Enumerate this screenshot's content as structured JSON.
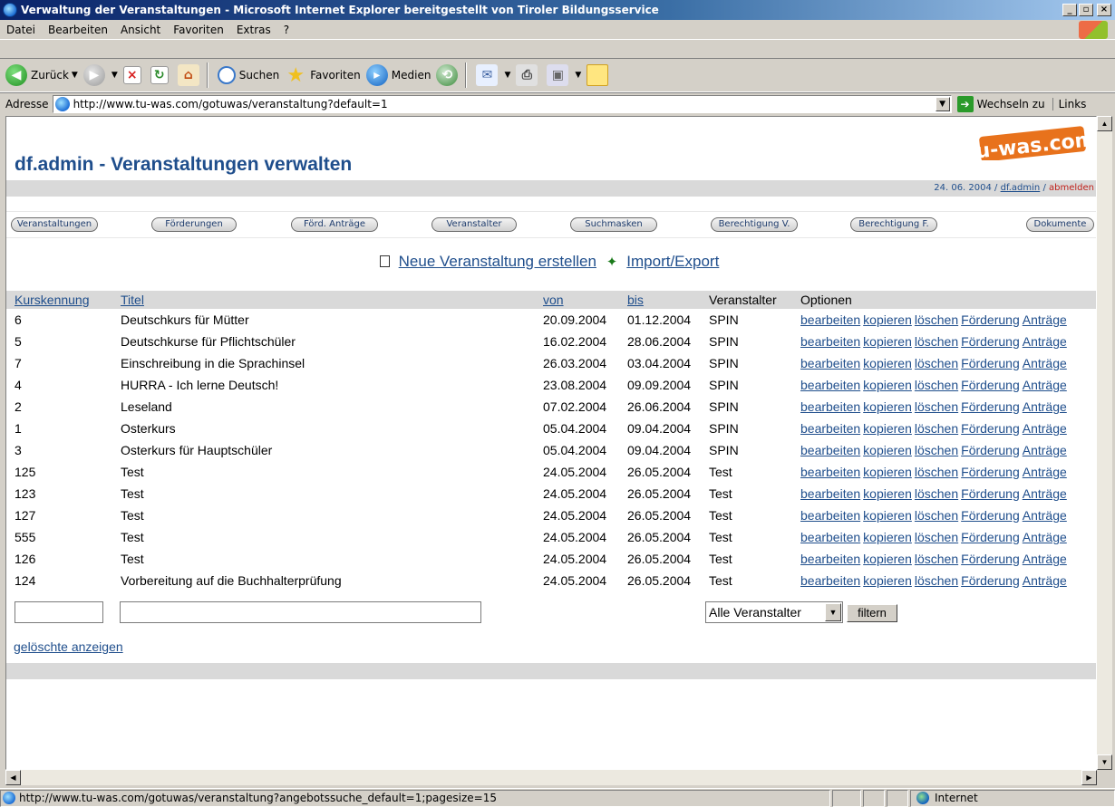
{
  "window": {
    "title": "Verwaltung der Veranstaltungen - Microsoft Internet Explorer bereitgestellt von Tiroler Bildungsservice",
    "min": "_",
    "max": "▫",
    "close": "×"
  },
  "menu": [
    "Datei",
    "Bearbeiten",
    "Ansicht",
    "Favoriten",
    "Extras",
    "?"
  ],
  "toolbar": {
    "back": "Zurück",
    "search": "Suchen",
    "favorites": "Favoriten",
    "media": "Medien"
  },
  "address": {
    "label": "Adresse",
    "url": "http://www.tu-was.com/gotuwas/veranstaltung?default=1",
    "go": "Wechseln zu",
    "links": "Links"
  },
  "page": {
    "title": "df.admin - Veranstaltungen verwalten",
    "logo": "tu-was.com",
    "date": "24. 06. 2004",
    "user": "df.admin",
    "logout": "abmelden",
    "nav": [
      "Veranstaltungen",
      "Förderungen",
      "Förd. Anträge",
      "Veranstalter",
      "Suchmasken",
      "Berechtigung V.",
      "Berechtigung F.",
      "Dokumente"
    ],
    "actions": {
      "new": "Neue Veranstaltung erstellen",
      "import": "Import/Export"
    },
    "headers": {
      "id": "Kurskennung",
      "title": "Titel",
      "from": "von",
      "to": "bis",
      "organizer": "Veranstalter",
      "options": "Optionen"
    },
    "option_labels": [
      "bearbeiten",
      "kopieren",
      "löschen",
      "Förderung",
      "Anträge"
    ],
    "rows": [
      [
        "6",
        "Deutschkurs für Mütter",
        "20.09.2004",
        "01.12.2004",
        "SPIN"
      ],
      [
        "5",
        "Deutschkurse für Pflichtschüler",
        "16.02.2004",
        "28.06.2004",
        "SPIN"
      ],
      [
        "7",
        "Einschreibung in die Sprachinsel",
        "26.03.2004",
        "03.04.2004",
        "SPIN"
      ],
      [
        "4",
        "HURRA - Ich lerne Deutsch!",
        "23.08.2004",
        "09.09.2004",
        "SPIN"
      ],
      [
        "2",
        "Leseland",
        "07.02.2004",
        "26.06.2004",
        "SPIN"
      ],
      [
        "1",
        "Osterkurs",
        "05.04.2004",
        "09.04.2004",
        "SPIN"
      ],
      [
        "3",
        "Osterkurs für Hauptschüler",
        "05.04.2004",
        "09.04.2004",
        "SPIN"
      ],
      [
        "125",
        "Test",
        "24.05.2004",
        "26.05.2004",
        "Test"
      ],
      [
        "123",
        "Test",
        "24.05.2004",
        "26.05.2004",
        "Test"
      ],
      [
        "127",
        "Test",
        "24.05.2004",
        "26.05.2004",
        "Test"
      ],
      [
        "555",
        "Test",
        "24.05.2004",
        "26.05.2004",
        "Test"
      ],
      [
        "126",
        "Test",
        "24.05.2004",
        "26.05.2004",
        "Test"
      ],
      [
        "124",
        "Vorbereitung auf die Buchhalterprüfung",
        "24.05.2004",
        "26.05.2004",
        "Test"
      ]
    ],
    "filter": {
      "organizer_value": "Alle Veranstalter",
      "button": "filtern"
    },
    "show_deleted": "gelöschte anzeigen"
  },
  "status": {
    "text": "http://www.tu-was.com/gotuwas/veranstaltung?angebotssuche_default=1;pagesize=15",
    "zone": "Internet"
  },
  "colors": {
    "title_bar": "#0a246a",
    "link": "#1f4e8c",
    "logout": "#c0201a",
    "info_bar": "#d9d9d9",
    "logo": "#e8721c"
  }
}
